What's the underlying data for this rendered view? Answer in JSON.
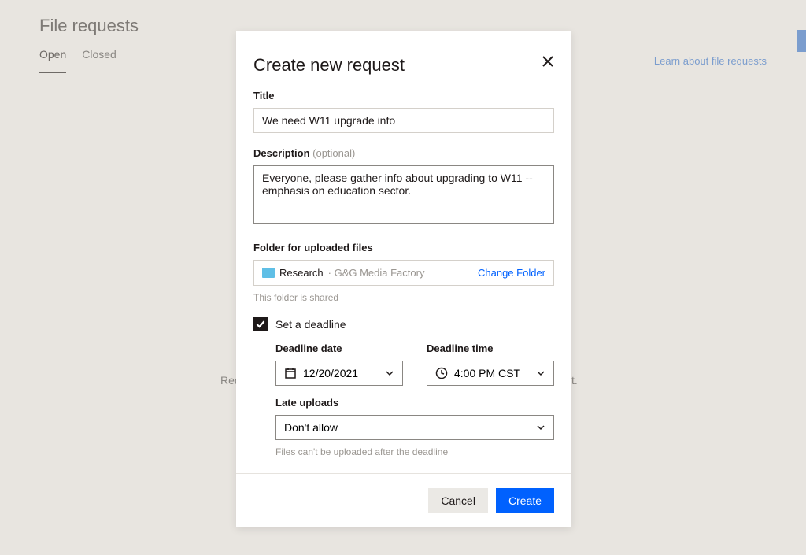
{
  "page": {
    "title": "File requests",
    "tabs": {
      "open": "Open",
      "closed": "Closed"
    },
    "learn_link": "Learn about file requests",
    "empty_prefix": "Req",
    "empty_suffix": "t."
  },
  "modal": {
    "title": "Create new request",
    "title_field": {
      "label": "Title",
      "value": "We need W11 upgrade info"
    },
    "description_field": {
      "label": "Description",
      "optional": "(optional)",
      "value": "Everyone, please gather info about upgrading to W11 -- emphasis on education sector."
    },
    "folder_field": {
      "label": "Folder for uploaded files",
      "name": "Research",
      "path": " · G&G Media Factory",
      "change": "Change Folder",
      "helper": "This folder is shared"
    },
    "deadline": {
      "checkbox_label": "Set a deadline",
      "date_label": "Deadline date",
      "date_value": "12/20/2021",
      "time_label": "Deadline time",
      "time_value": "4:00 PM CST",
      "late_label": "Late uploads",
      "late_value": "Don't allow",
      "late_helper": "Files can't be uploaded after the deadline"
    },
    "footer": {
      "cancel": "Cancel",
      "create": "Create"
    }
  }
}
